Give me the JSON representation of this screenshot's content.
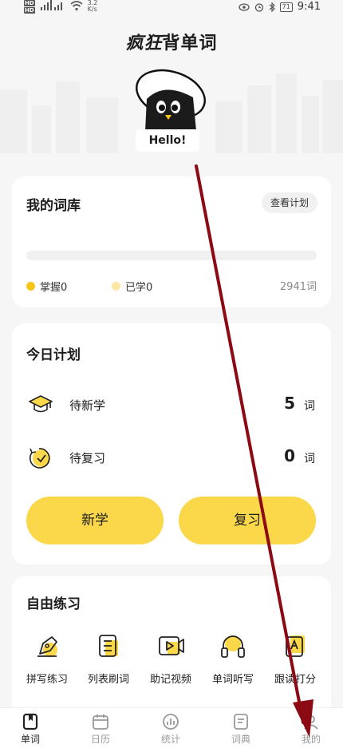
{
  "status_bar": {
    "sim1": "HD",
    "sim2": "HD",
    "network_speed": "3.2",
    "speed_unit": "K/s",
    "battery": "71",
    "time": "9:41"
  },
  "header": {
    "title_part1": "疯狂",
    "title_part2": "背单词",
    "mascot_greeting": "Hello!"
  },
  "library": {
    "title": "我的词库",
    "view_plan_label": "查看计划",
    "progress": 0,
    "mastered_label": "掌握0",
    "learned_label": "已学0",
    "total_label": "2941词",
    "mastered_color": "#f5c518",
    "learned_color": "#fde7a3"
  },
  "plan": {
    "title": "今日计划",
    "rows": [
      {
        "label": "待新学",
        "count": "5",
        "unit": "词",
        "icon": "graduation-cap-icon"
      },
      {
        "label": "待复习",
        "count": "0",
        "unit": "词",
        "icon": "review-clock-icon"
      }
    ],
    "learn_button": "新学",
    "review_button": "复习",
    "accent_color": "#fbd84a"
  },
  "practice": {
    "title": "自由练习",
    "items": [
      {
        "label": "拼写练习",
        "icon": "pen-icon"
      },
      {
        "label": "列表刷词",
        "icon": "list-icon"
      },
      {
        "label": "助记视频",
        "icon": "video-icon"
      },
      {
        "label": "单词听写",
        "icon": "headphones-icon"
      },
      {
        "label": "跟读打分",
        "icon": "pronounce-icon"
      }
    ]
  },
  "tabbar": {
    "tabs": [
      {
        "label": "单词",
        "icon": "book-icon",
        "active": true
      },
      {
        "label": "日历",
        "icon": "calendar-icon",
        "active": false
      },
      {
        "label": "统计",
        "icon": "stats-icon",
        "active": false
      },
      {
        "label": "词典",
        "icon": "dictionary-icon",
        "active": false
      },
      {
        "label": "我的",
        "icon": "profile-icon",
        "active": false
      }
    ]
  },
  "annotation_color": "#8b0a14"
}
